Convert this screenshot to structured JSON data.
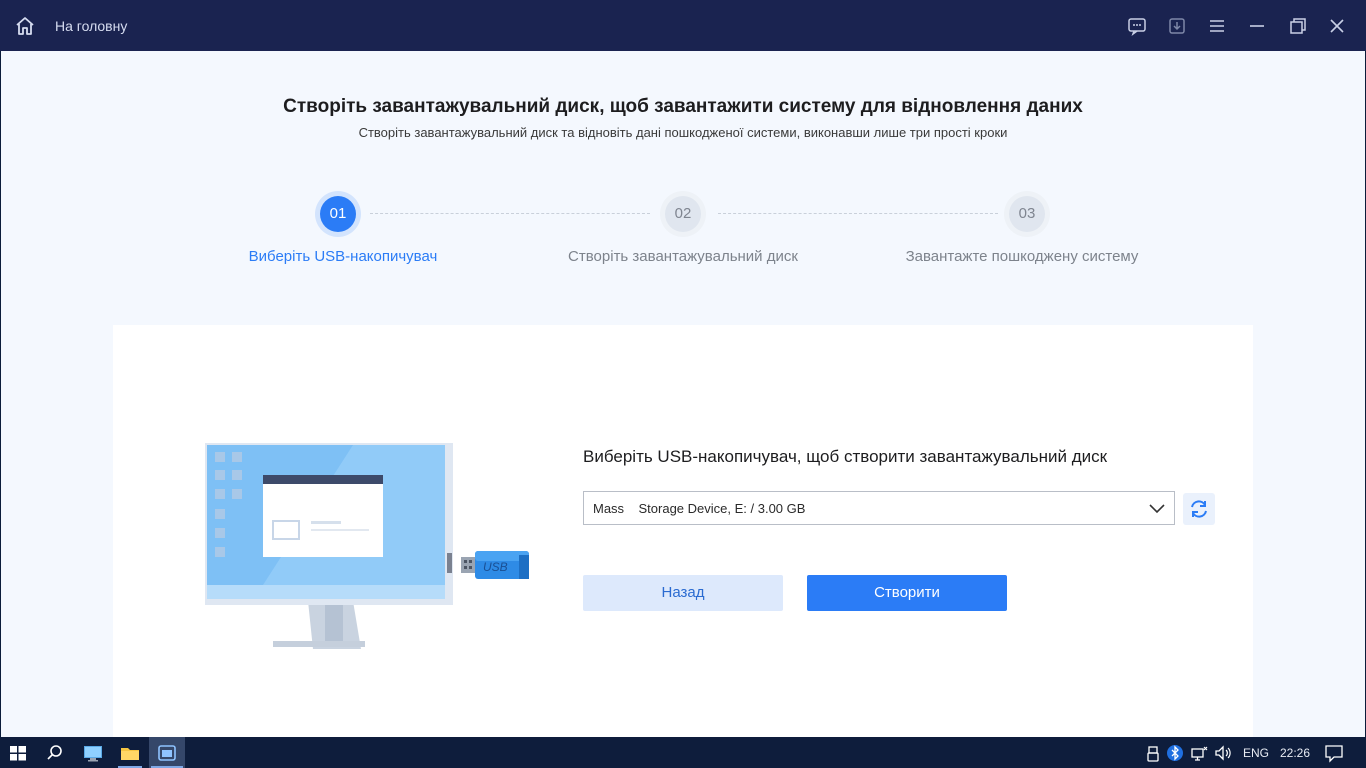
{
  "titlebar": {
    "home_label": "На головну",
    "icons": [
      "home-icon",
      "feedback-icon",
      "download-icon",
      "menu-icon",
      "minimize-icon",
      "restore-icon",
      "close-icon"
    ]
  },
  "header": {
    "title": "Створіть завантажувальний диск, щоб завантажити систему для відновлення даних",
    "subtitle": "Створіть завантажувальний диск та відновіть дані пошкодженої системи, виконавши лише три прості кроки"
  },
  "steps": [
    {
      "number": "01",
      "label": "Виберіть USB-накопичувач",
      "active": true
    },
    {
      "number": "02",
      "label": "Створіть завантажувальний диск",
      "active": false
    },
    {
      "number": "03",
      "label": "Завантажте пошкоджену систему",
      "active": false
    }
  ],
  "card": {
    "title": "Виберіть USB-накопичувач, щоб створити завантажувальний диск",
    "usb_label": "USB",
    "device_select": {
      "value": "Mass    Storage Device, E: / 3.00 GB"
    },
    "back_button": "Назад",
    "create_button": "Створити"
  },
  "taskbar": {
    "icons": [
      "windows-start-icon",
      "search-icon",
      "this-pc-icon",
      "file-explorer-icon",
      "app-icon"
    ],
    "tray_icons": [
      "usb-icon",
      "bluetooth-icon",
      "network-icon",
      "volume-icon"
    ],
    "language": "ENG",
    "time": "22:26"
  },
  "colors": {
    "accent": "#2b7cf6",
    "titlebar": "#1a2350",
    "taskbar": "#0e1d3c"
  }
}
